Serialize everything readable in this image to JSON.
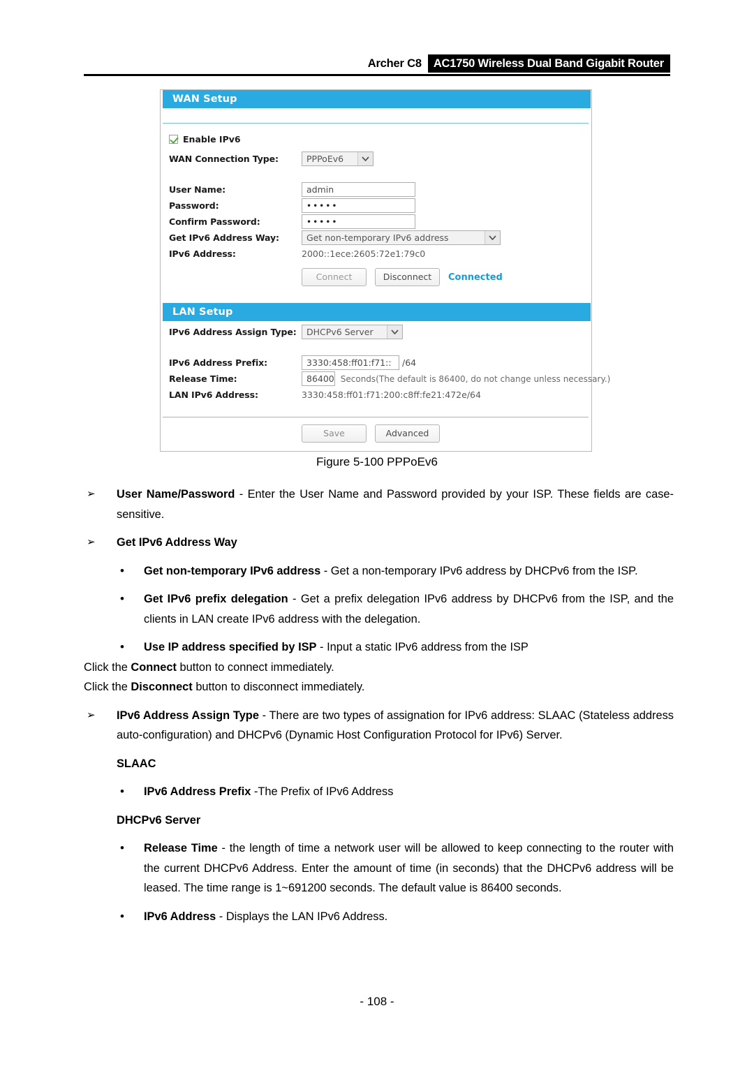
{
  "header": {
    "model": "Archer C8",
    "product": "AC1750 Wireless Dual Band Gigabit Router"
  },
  "router_ui": {
    "wan_section": {
      "title": "WAN Setup",
      "enable_ipv6_label": "Enable IPv6",
      "enable_ipv6_checked": true,
      "fields": {
        "wan_connection_type_label": "WAN Connection Type:",
        "wan_connection_type_value": "PPPoEv6",
        "user_name_label": "User Name:",
        "user_name_value": "admin",
        "password_label": "Password:",
        "password_value": "•••••",
        "confirm_password_label": "Confirm Password:",
        "confirm_password_value": "•••••",
        "get_ipv6_way_label": "Get IPv6 Address Way:",
        "get_ipv6_way_value": "Get non-temporary IPv6 address",
        "ipv6_address_label": "IPv6 Address:",
        "ipv6_address_value": "2000::1ece:2605:72e1:79c0"
      },
      "buttons": {
        "connect": "Connect",
        "disconnect": "Disconnect"
      },
      "status": "Connected"
    },
    "lan_section": {
      "title": "LAN Setup",
      "fields": {
        "assign_type_label": "IPv6 Address Assign Type:",
        "assign_type_value": "DHCPv6 Server",
        "prefix_label": "IPv6 Address Prefix:",
        "prefix_value": "3330:458:ff01:f71::",
        "prefix_suffix": "/64",
        "release_time_label": "Release Time:",
        "release_time_value": "86400",
        "release_time_hint": "Seconds(The default is 86400, do not change unless necessary.)",
        "lan_ipv6_label": "LAN IPv6 Address:",
        "lan_ipv6_value": "3330:458:ff01:f71:200:c8ff:fe21:472e/64"
      }
    },
    "footer_buttons": {
      "save": "Save",
      "advanced": "Advanced"
    },
    "colors": {
      "bar_blue": "#29abe2",
      "status_blue": "#1b9ad6",
      "check_green": "#4faa3c"
    }
  },
  "figure_caption": "Figure 5-100 PPPoEv6",
  "body": {
    "arrow_marker": "➢",
    "dot_marker": "•",
    "items": [
      {
        "level": 1,
        "bold": "User Name/Password",
        "text": " - Enter the User Name and Password provided by your ISP. These fields are case-sensitive."
      },
      {
        "level": 1,
        "bold": "Get IPv6 Address Way",
        "text": ""
      },
      {
        "level": 2,
        "bold": "Get non-temporary IPv6 address",
        "text": " - Get a non-temporary IPv6 address by DHCPv6 from the ISP."
      },
      {
        "level": 2,
        "bold": "Get IPv6 prefix delegation",
        "text": " - Get a prefix delegation IPv6 address by DHCPv6 from the ISP, and the clients in LAN create IPv6 address with the delegation."
      },
      {
        "level": 2,
        "bold": "Use IP address specified by ISP",
        "text": " - Input a static IPv6 address from the ISP"
      }
    ],
    "connect_line": {
      "pre": "Click the ",
      "bold": "Connect",
      "post": " button to connect immediately."
    },
    "disconnect_line": {
      "pre": "Click the ",
      "bold": "Disconnect",
      "post": " button to disconnect immediately."
    },
    "assign_type_item": {
      "bold": "IPv6 Address Assign Type",
      "text": " - There are two types of assignation for IPv6 address: SLAAC (Stateless address auto-configuration) and DHCPv6 (Dynamic Host Configuration Protocol for IPv6) Server."
    },
    "slaac_heading": "SLAAC",
    "slaac_item": {
      "bold": "IPv6 Address Prefix",
      "text": " -The Prefix of IPv6 Address"
    },
    "dhcpv6_heading": "DHCPv6 Server",
    "release_time_item": {
      "bold": "Release Time",
      "text": " - the length of time a network user will be allowed to keep connecting to the router with the current DHCPv6 Address. Enter the amount of time (in seconds) that the DHCPv6 address will be leased. The time range is 1~691200 seconds. The default value is 86400 seconds."
    },
    "ipv6_address_item": {
      "bold": "IPv6 Address",
      "text": " - Displays the LAN IPv6 Address."
    }
  },
  "page_number": "- 108 -"
}
